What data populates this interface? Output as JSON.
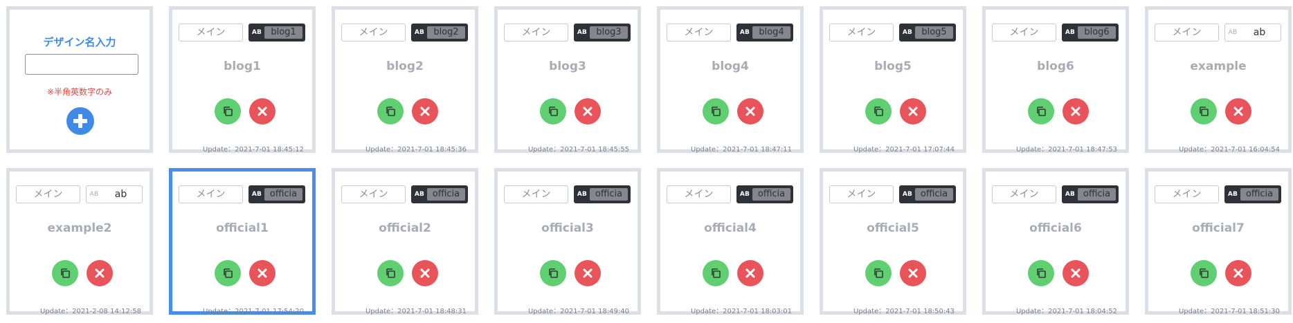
{
  "add_card": {
    "title": "デザイン名入力",
    "input_value": "",
    "note": "※半角英数字のみ"
  },
  "labels": {
    "main": "メイン",
    "ab": "AB",
    "update_prefix": "Update："
  },
  "colors": {
    "accent": "#3e8ae6",
    "copy": "#5fcf72",
    "delete": "#e8545a",
    "selected_border": "#4a8de8"
  },
  "icons": {
    "copy": "copy-icon",
    "delete": "close-icon",
    "add": "plus-icon"
  },
  "designs": [
    {
      "name": "blog1",
      "ab_value": "blog1",
      "ab_style": "dark",
      "updated": "2021-7-01 18:45:12",
      "selected": false
    },
    {
      "name": "blog2",
      "ab_value": "blog2",
      "ab_style": "dark",
      "updated": "2021-7-01 18:45:36",
      "selected": false
    },
    {
      "name": "blog3",
      "ab_value": "blog3",
      "ab_style": "dark",
      "updated": "2021-7-01 18:45:55",
      "selected": false
    },
    {
      "name": "blog4",
      "ab_value": "blog4",
      "ab_style": "dark",
      "updated": "2021-7-01 18:47:11",
      "selected": false
    },
    {
      "name": "blog5",
      "ab_value": "blog5",
      "ab_style": "dark",
      "updated": "2021-7-01 17:07:44",
      "selected": false
    },
    {
      "name": "blog6",
      "ab_value": "blog6",
      "ab_style": "dark",
      "updated": "2021-7-01 18:47:53",
      "selected": false
    },
    {
      "name": "example",
      "ab_value": "ab",
      "ab_style": "light",
      "updated": "2021-7-01 16:04:54",
      "selected": false
    },
    {
      "name": "example2",
      "ab_value": "ab",
      "ab_style": "light",
      "updated": "2021-2-08 14:12:58",
      "selected": false
    },
    {
      "name": "official1",
      "ab_value": "officia",
      "ab_style": "dark",
      "updated": "2021-7-01 17:54:20",
      "selected": true
    },
    {
      "name": "official2",
      "ab_value": "officia",
      "ab_style": "dark",
      "updated": "2021-7-01 18:48:31",
      "selected": false
    },
    {
      "name": "official3",
      "ab_value": "officia",
      "ab_style": "dark",
      "updated": "2021-7-01 18:49:40",
      "selected": false
    },
    {
      "name": "official4",
      "ab_value": "officia",
      "ab_style": "dark",
      "updated": "2021-7-01 18:03:01",
      "selected": false
    },
    {
      "name": "official5",
      "ab_value": "officia",
      "ab_style": "dark",
      "updated": "2021-7-01 18:50:43",
      "selected": false
    },
    {
      "name": "official6",
      "ab_value": "officia",
      "ab_style": "dark",
      "updated": "2021-7-01 18:04:52",
      "selected": false
    },
    {
      "name": "official7",
      "ab_value": "officia",
      "ab_style": "dark",
      "updated": "2021-7-01 18:51:30",
      "selected": false
    }
  ]
}
